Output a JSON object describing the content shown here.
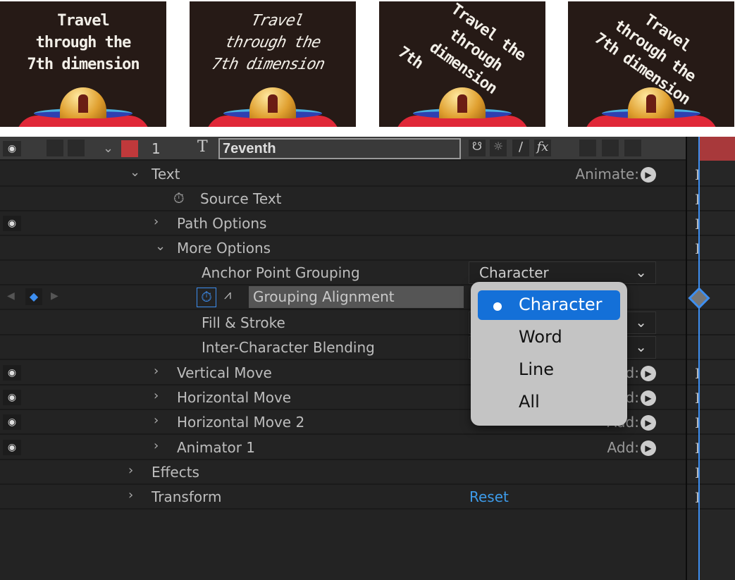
{
  "thumbnails": [
    {
      "lines": [
        "Travel",
        "through the",
        "7th dimension"
      ]
    },
    {
      "lines": [
        "Travel",
        "through the",
        "7th dimension"
      ]
    },
    {
      "lines": [
        "Travel the",
        "through",
        "dimension",
        "7th"
      ]
    },
    {
      "lines": [
        "Travel",
        "through the",
        "7th dimension"
      ]
    }
  ],
  "layer": {
    "eye_icon": "eye-icon",
    "number": "1",
    "type_icon": "T",
    "name": "7eventh",
    "switches": [
      "shy-icon",
      "collapse-icon",
      "quality-icon",
      "fx"
    ],
    "label_color": "#c0393b"
  },
  "rows": {
    "text": "Text",
    "animate": "Animate:",
    "source_text": "Source Text",
    "path_options": "Path Options",
    "more_options": "More Options",
    "anchor_point_grouping": "Anchor Point Grouping",
    "anchor_value": "Character",
    "grouping_alignment": "Grouping Alignment",
    "fill_stroke": "Fill & Stroke",
    "inter_char": "Inter-Character Blending",
    "vertical_move": "Vertical Move",
    "horizontal_move": "Horizontal Move",
    "horizontal_move_2": "Horizontal Move 2",
    "animator_1": "Animator 1",
    "add": "Add:",
    "effects": "Effects",
    "transform": "Transform",
    "reset": "Reset"
  },
  "menu": {
    "options": [
      "Character",
      "Word",
      "Line",
      "All"
    ],
    "selected": "Character"
  },
  "colors": {
    "accent": "#1470d8",
    "playhead": "#3d8ef0",
    "reset": "#3d9be9"
  }
}
